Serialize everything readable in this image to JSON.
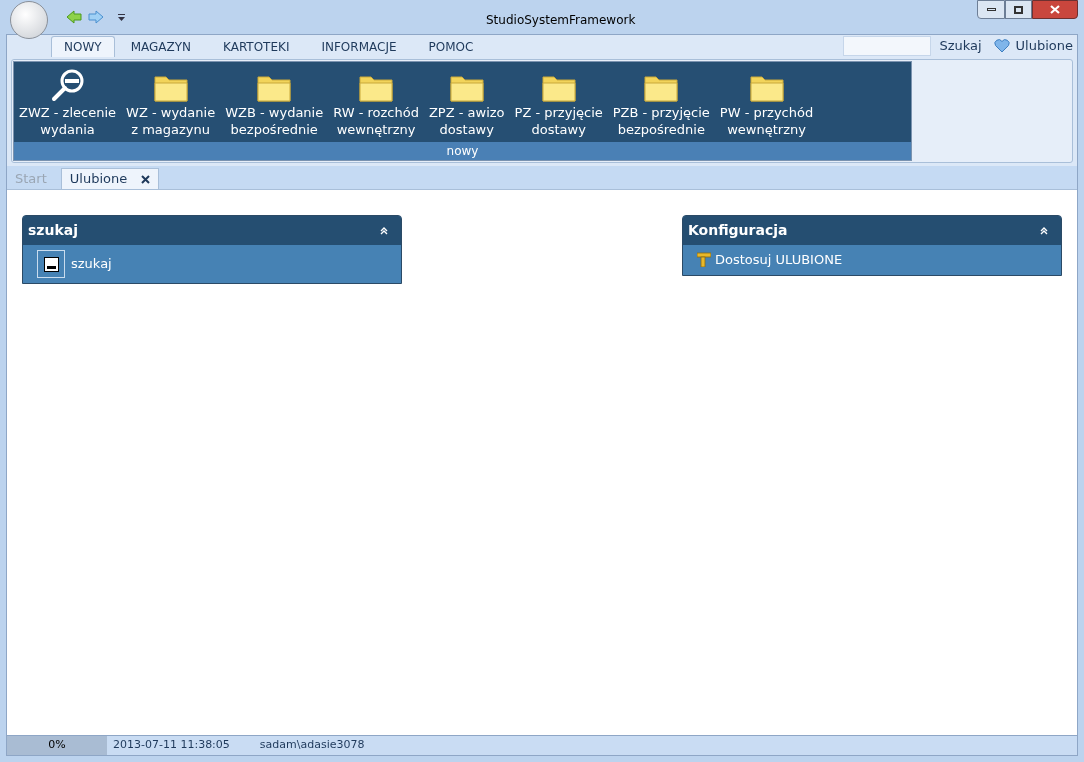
{
  "window": {
    "title": "StudioSystemFramework"
  },
  "ribbon_tabs": [
    {
      "label": "NOWY",
      "selected": true
    },
    {
      "label": "MAGAZYN",
      "selected": false
    },
    {
      "label": "KARTOTEKI",
      "selected": false
    },
    {
      "label": "INFORMACJE",
      "selected": false
    },
    {
      "label": "POMOC",
      "selected": false
    }
  ],
  "search": {
    "button": "Szukaj"
  },
  "favorites": {
    "label": "Ulubione"
  },
  "ribbon_group": {
    "label": "nowy",
    "buttons": [
      {
        "kind": "search",
        "label": "ZWZ - zlecenie\nwydania"
      },
      {
        "kind": "folder",
        "label": "WZ - wydanie\nz magazynu"
      },
      {
        "kind": "folder",
        "label": "WZB - wydanie\nbezpośrednie"
      },
      {
        "kind": "folder",
        "label": "RW - rozchód\nwewnętrzny"
      },
      {
        "kind": "folder",
        "label": "ZPZ - awizo\ndostawy"
      },
      {
        "kind": "folder",
        "label": "PZ - przyjęcie\ndostawy"
      },
      {
        "kind": "folder",
        "label": "PZB - przyjęcie\nbezpośrednie"
      },
      {
        "kind": "folder",
        "label": "PW - przychód\nwewnętrzny"
      }
    ]
  },
  "doc_tabs": [
    {
      "label": "Start",
      "selected": false,
      "closable": false
    },
    {
      "label": "Ulubione",
      "selected": true,
      "closable": true
    }
  ],
  "panels": [
    {
      "title": "szukaj",
      "items": [
        {
          "kind": "search",
          "label": "szukaj"
        }
      ]
    },
    {
      "title": "Konfiguracja",
      "items": [
        {
          "kind": "config",
          "label": "Dostosuj ULUBIONE"
        }
      ]
    }
  ],
  "status_bar": {
    "progress": {
      "level": 0,
      "reading": "0%"
    },
    "datetime": "2013-07-11 11:38:05",
    "user": "sadam\\adasie3078"
  }
}
